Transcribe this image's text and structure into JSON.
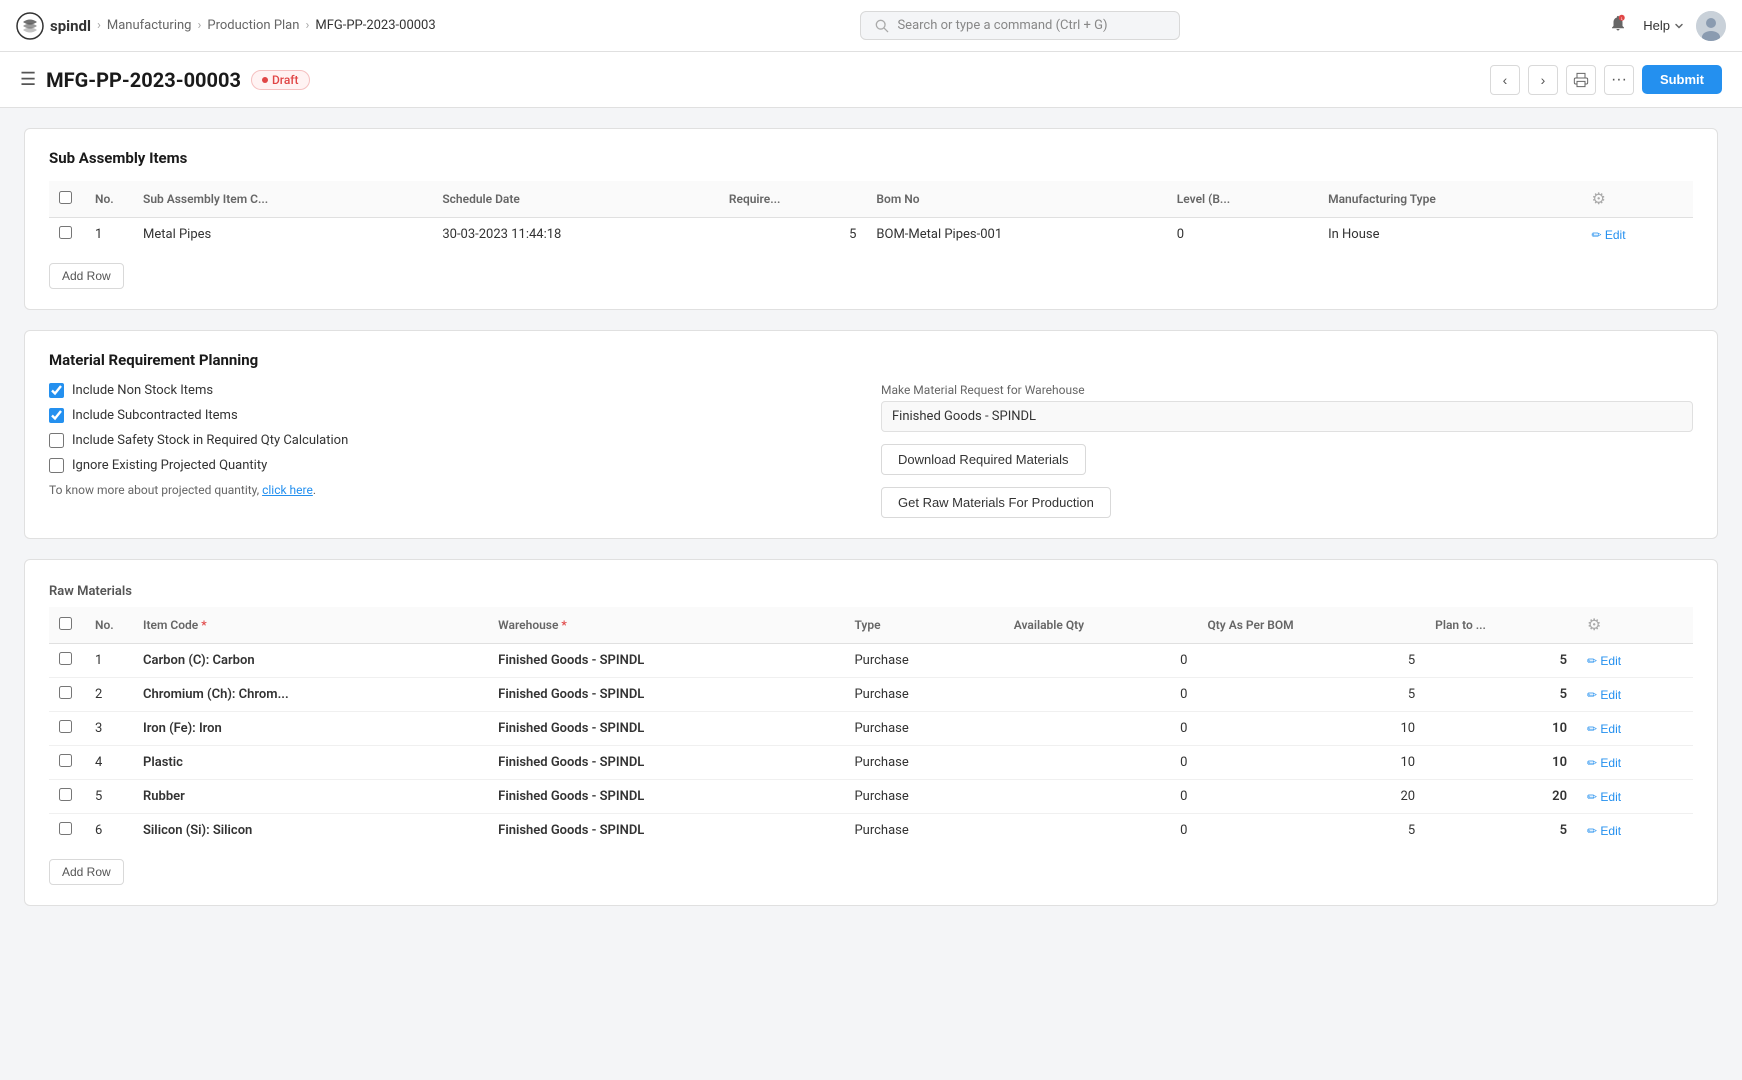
{
  "app": {
    "logo_text": "spindl",
    "breadcrumbs": [
      "Manufacturing",
      "Production Plan",
      "MFG-PP-2023-00003"
    ],
    "search_placeholder": "Search or type a command (Ctrl + G)"
  },
  "header": {
    "doc_id": "MFG-PP-2023-00003",
    "status": "Draft",
    "nav_prev": "‹",
    "nav_next": "›",
    "submit_label": "Submit"
  },
  "subassembly": {
    "section_title": "Sub Assembly Items",
    "columns": [
      "No.",
      "Sub Assembly Item C...",
      "Schedule Date",
      "Require...",
      "Bom No",
      "Level (B...",
      "Manufacturing Type"
    ],
    "rows": [
      {
        "no": 1,
        "item_code": "Metal Pipes",
        "schedule_date": "30-03-2023 11:44:18",
        "required": "5",
        "bom_no": "BOM-Metal Pipes-001",
        "level": "0",
        "mfg_type": "In House"
      }
    ],
    "add_row_label": "Add Row"
  },
  "mrp": {
    "section_title": "Material Requirement Planning",
    "checkboxes": [
      {
        "id": "include_non_stock",
        "label": "Include Non Stock Items",
        "checked": true
      },
      {
        "id": "include_subcontracted",
        "label": "Include Subcontracted Items",
        "checked": true
      },
      {
        "id": "include_safety_stock",
        "label": "Include Safety Stock in Required Qty Calculation",
        "checked": false
      },
      {
        "id": "ignore_projected",
        "label": "Ignore Existing Projected Quantity",
        "checked": false
      }
    ],
    "info_text": "To know more about projected quantity, ",
    "info_link": "click here",
    "warehouse_label": "Make Material Request for Warehouse",
    "warehouse_value": "Finished Goods - SPINDL",
    "btn_download": "Download Required Materials",
    "btn_get_raw": "Get Raw Materials For Production"
  },
  "raw_materials": {
    "section_title": "Raw Materials",
    "columns": [
      "No.",
      "Item Code *",
      "Warehouse *",
      "Type",
      "Available Qty",
      "Qty As Per BOM",
      "Plan to ..."
    ],
    "rows": [
      {
        "no": 1,
        "item_code": "Carbon (C): Carbon",
        "warehouse": "Finished Goods - SPINDL",
        "type": "Purchase",
        "available_qty": 0,
        "qty_per_bom": 5,
        "plan_to": 5
      },
      {
        "no": 2,
        "item_code": "Chromium (Ch): Chrom...",
        "warehouse": "Finished Goods - SPINDL",
        "type": "Purchase",
        "available_qty": 0,
        "qty_per_bom": 5,
        "plan_to": 5
      },
      {
        "no": 3,
        "item_code": "Iron (Fe): Iron",
        "warehouse": "Finished Goods - SPINDL",
        "type": "Purchase",
        "available_qty": 0,
        "qty_per_bom": 10,
        "plan_to": 10
      },
      {
        "no": 4,
        "item_code": "Plastic",
        "warehouse": "Finished Goods - SPINDL",
        "type": "Purchase",
        "available_qty": 0,
        "qty_per_bom": 10,
        "plan_to": 10
      },
      {
        "no": 5,
        "item_code": "Rubber",
        "warehouse": "Finished Goods - SPINDL",
        "type": "Purchase",
        "available_qty": 0,
        "qty_per_bom": 20,
        "plan_to": 20
      },
      {
        "no": 6,
        "item_code": "Silicon (Si): Silicon",
        "warehouse": "Finished Goods - SPINDL",
        "type": "Purchase",
        "available_qty": 0,
        "qty_per_bom": 5,
        "plan_to": 5
      }
    ],
    "add_row_label": "Add Row"
  }
}
